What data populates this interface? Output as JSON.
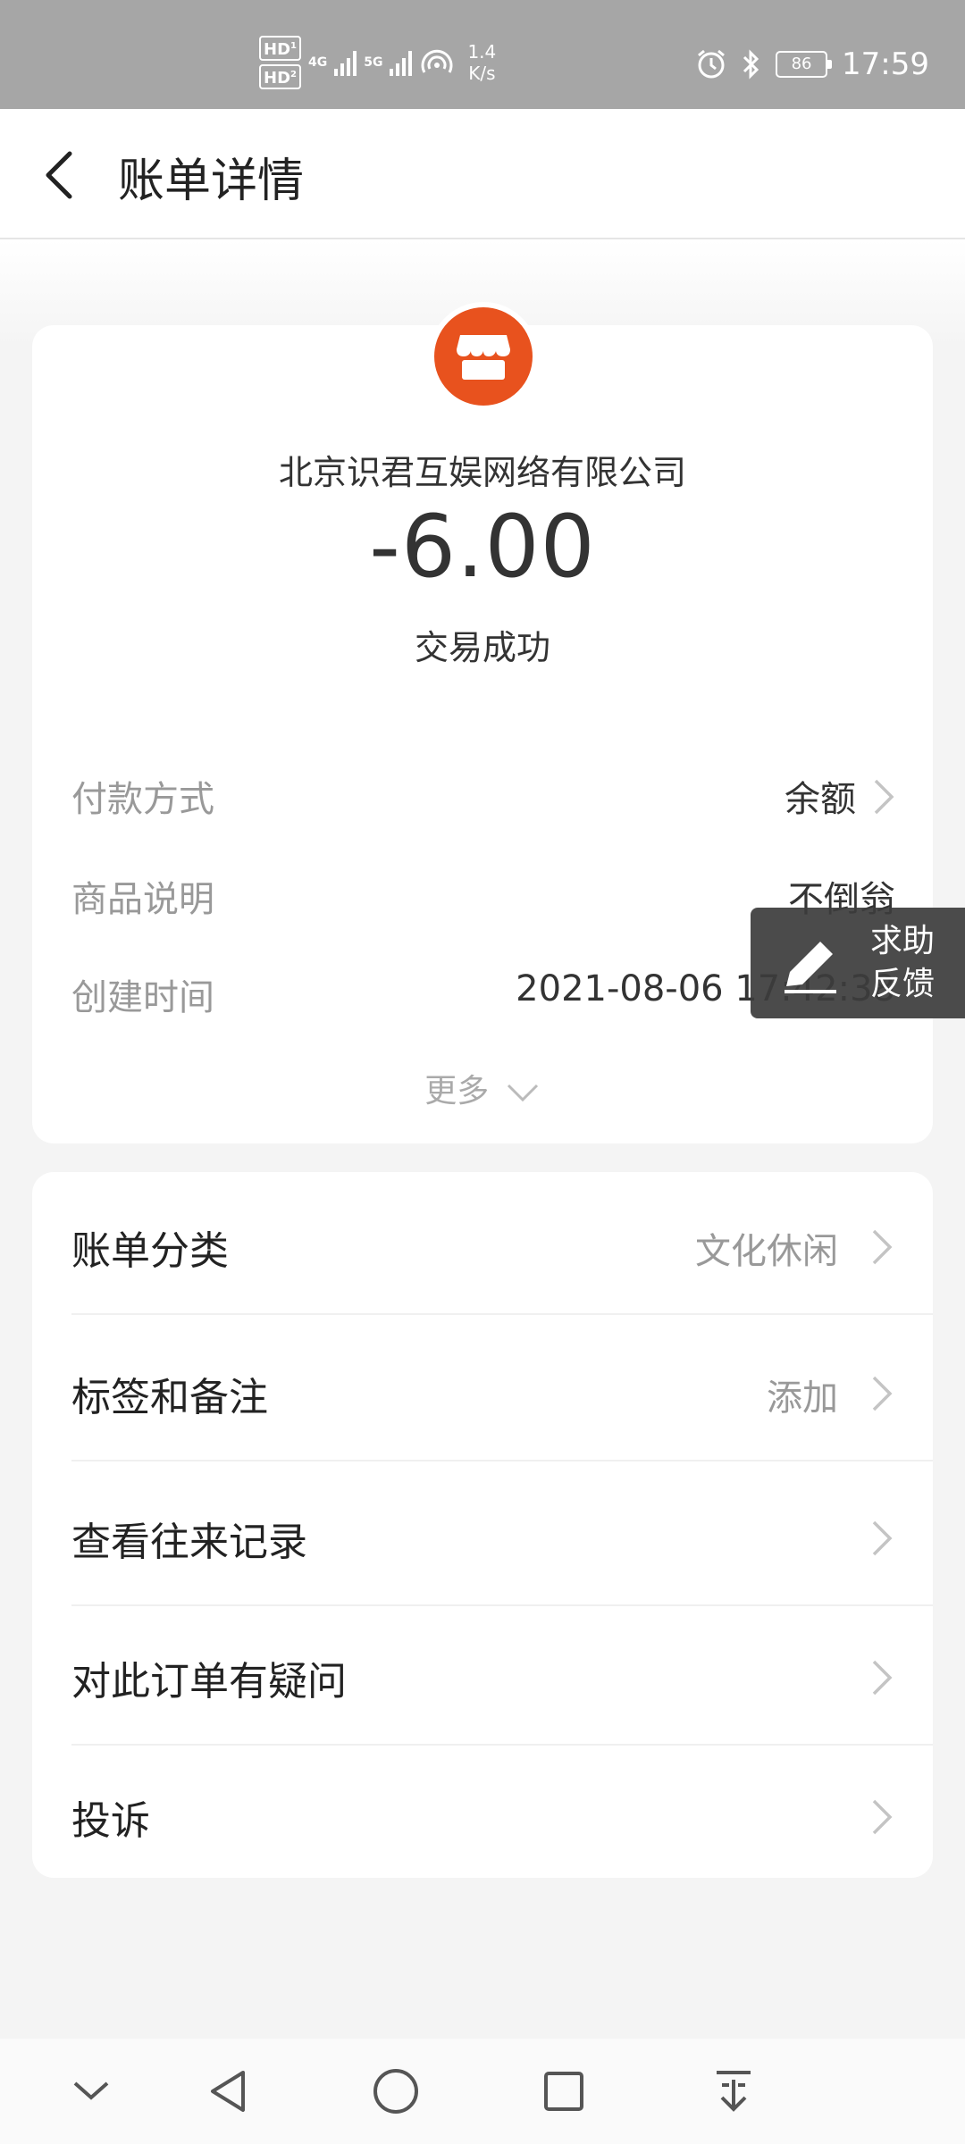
{
  "status_bar": {
    "hd1": "HD",
    "hd1_sub": "1",
    "hd2": "HD",
    "hd2_sub": "2",
    "net1": "4G",
    "net2": "5G",
    "speed_value": "1.4",
    "speed_unit": "K/s",
    "battery": "86",
    "time": "17:59",
    "icons": [
      "alarm-icon",
      "bluetooth-icon",
      "hotspot-icon",
      "signal-icon",
      "battery-icon"
    ]
  },
  "header": {
    "title": "账单详情",
    "back_icon": "chevron-left-icon"
  },
  "summary": {
    "merchant_icon": "store-icon",
    "merchant_color": "#e8521e",
    "merchant_name": "北京识君互娱网络有限公司",
    "amount": "-6.00",
    "status": "交易成功"
  },
  "details": [
    {
      "label": "付款方式",
      "value": "余额",
      "has_arrow": true
    },
    {
      "label": "商品说明",
      "value": "不倒翁",
      "has_arrow": false
    },
    {
      "label": "创建时间",
      "value": "2021-08-06 17:42:38",
      "has_arrow": false
    }
  ],
  "more_label": "更多",
  "feedback": {
    "line1": "求助",
    "line2": "反馈",
    "icon": "pencil-icon"
  },
  "actions": [
    {
      "label": "账单分类",
      "value": "文化休闲"
    },
    {
      "label": "标签和备注",
      "value": "添加"
    },
    {
      "label": "查看往来记录",
      "value": ""
    },
    {
      "label": "对此订单有疑问",
      "value": ""
    },
    {
      "label": "投诉",
      "value": ""
    }
  ],
  "nav_bar": {
    "icons": [
      "collapse-icon",
      "back-triangle-icon",
      "home-circle-icon",
      "recents-square-icon",
      "notification-pull-icon"
    ]
  }
}
